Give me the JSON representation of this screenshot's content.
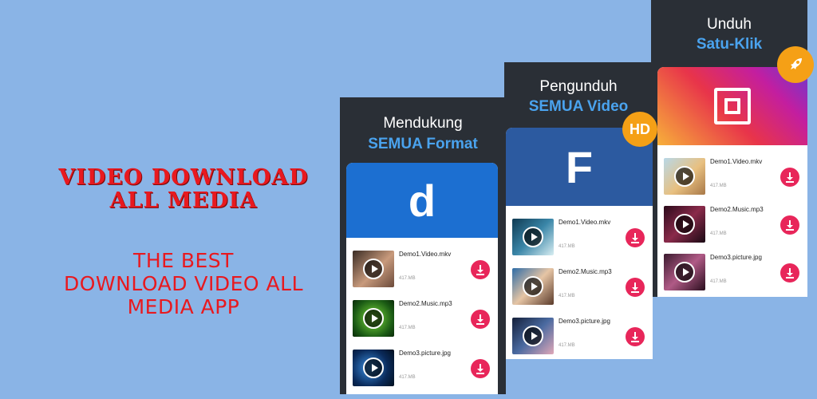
{
  "promo": {
    "title_line1": "VIDEO DOWNLOAD",
    "title_line2": "ALL MEDIA",
    "subtitle_line1": "THE BEST",
    "subtitle_line2": "DOWNLOAD VIDEO ALL",
    "subtitle_line3": "MEDIA APP"
  },
  "colors": {
    "background": "#8ab4e6",
    "title_red": "#e8191f",
    "heading_blue": "#4aa3ee",
    "download_pink": "#e8265a",
    "dailymotion_blue": "#1c6fd1",
    "facebook_blue": "#2c5aa0",
    "badge_orange": "#f5a016"
  },
  "phones": [
    {
      "heading_line1": "Mendukung",
      "heading_line2": "SEMUA Format",
      "banner_glyph": "d",
      "banner_icon": "dailymotion-logo",
      "items": [
        {
          "name": "Demo1.Video.mkv",
          "size": "417.MB"
        },
        {
          "name": "Demo2.Music.mp3",
          "size": "417.MB"
        },
        {
          "name": "Demo3.picture.jpg",
          "size": "417.MB"
        }
      ]
    },
    {
      "heading_line1": "Pengunduh",
      "heading_line2": "SEMUA Video",
      "badge": "HD",
      "banner_glyph": "F",
      "banner_icon": "facebook-logo",
      "items": [
        {
          "name": "Demo1.Video.mkv",
          "size": "417.MB"
        },
        {
          "name": "Demo2.Music.mp3",
          "size": "417.MB"
        },
        {
          "name": "Demo3.picture.jpg",
          "size": "417.MB"
        }
      ]
    },
    {
      "heading_line1": "Unduh",
      "heading_line2": "Satu-Klik",
      "badge_icon": "rocket-icon",
      "banner_icon": "instagram-logo",
      "items": [
        {
          "name": "Demo1.Video.mkv",
          "size": "417.MB"
        },
        {
          "name": "Demo2.Music.mp3",
          "size": "417.MB"
        },
        {
          "name": "Demo3.picture.jpg",
          "size": "417.MB"
        }
      ]
    }
  ]
}
